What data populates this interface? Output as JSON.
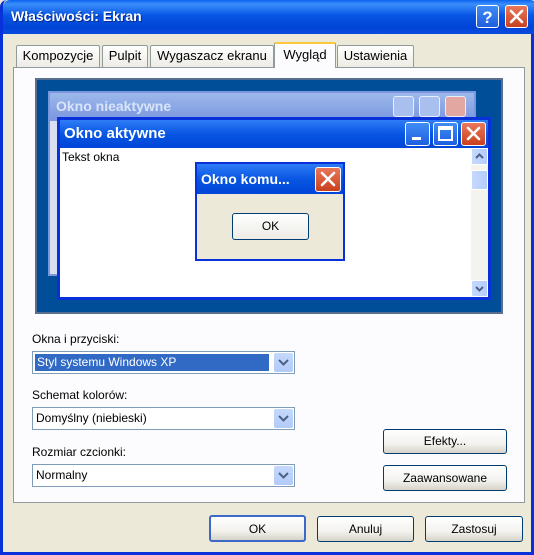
{
  "window": {
    "title": "Właściwości: Ekran"
  },
  "tabs": [
    {
      "label": "Kompozycje"
    },
    {
      "label": "Pulpit"
    },
    {
      "label": "Wygaszacz ekranu"
    },
    {
      "label": "Wygląd"
    },
    {
      "label": "Ustawienia"
    }
  ],
  "active_tab": "Wygląd",
  "preview": {
    "inactive_title": "Okno nieaktywne",
    "active_title": "Okno aktywne",
    "window_text": "Tekst okna",
    "message_title": "Okno komu...",
    "ok_label": "OK"
  },
  "fields": {
    "windows_buttons": {
      "label": "Okna i przyciski:",
      "value": "Styl systemu Windows XP"
    },
    "color_scheme": {
      "label": "Schemat kolorów:",
      "value": "Domyślny (niebieski)"
    },
    "font_size": {
      "label": "Rozmiar czcionki:",
      "value": "Normalny"
    }
  },
  "buttons": {
    "effects": "Efekty...",
    "advanced": "Zaawansowane",
    "ok": "OK",
    "cancel": "Anuluj",
    "apply": "Zastosuj"
  },
  "colors": {
    "titlebar": "#0856e3",
    "preview_desktop": "#004e98",
    "close_button": "#d9522e",
    "selection": "#316ac5",
    "dialog_face": "#ece9d8"
  }
}
